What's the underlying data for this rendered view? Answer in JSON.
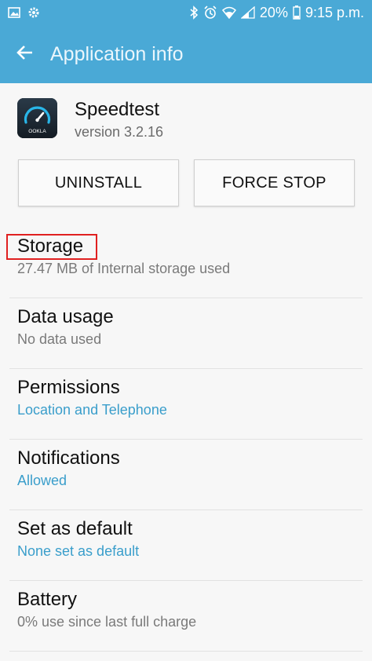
{
  "status_bar": {
    "battery_percent": "20%",
    "time": "9:15 p.m.",
    "icons": [
      "gallery-icon",
      "settings-gear-icon",
      "bluetooth-icon",
      "alarm-icon",
      "wifi-icon",
      "signal-icon",
      "battery-icon"
    ]
  },
  "app_bar": {
    "back_icon": "arrow-left-icon",
    "title": "Application info"
  },
  "app": {
    "name": "Speedtest",
    "version": "version 3.2.16",
    "icon_text": "OOKLA"
  },
  "buttons": {
    "uninstall": "UNINSTALL",
    "force_stop": "FORCE STOP"
  },
  "items": [
    {
      "title": "Storage",
      "subtitle": "27.47 MB of Internal storage used",
      "subtitle_color": "gray"
    },
    {
      "title": "Data usage",
      "subtitle": "No data used",
      "subtitle_color": "gray"
    },
    {
      "title": "Permissions",
      "subtitle": "Location and Telephone",
      "subtitle_color": "blue"
    },
    {
      "title": "Notifications",
      "subtitle": "Allowed",
      "subtitle_color": "blue"
    },
    {
      "title": "Set as default",
      "subtitle": "None set as default",
      "subtitle_color": "blue"
    },
    {
      "title": "Battery",
      "subtitle": "0% use since last full charge",
      "subtitle_color": "gray"
    }
  ],
  "colors": {
    "accent": "#4aa9d6",
    "link_blue": "#3a9ecb",
    "highlight": "#e02020"
  }
}
